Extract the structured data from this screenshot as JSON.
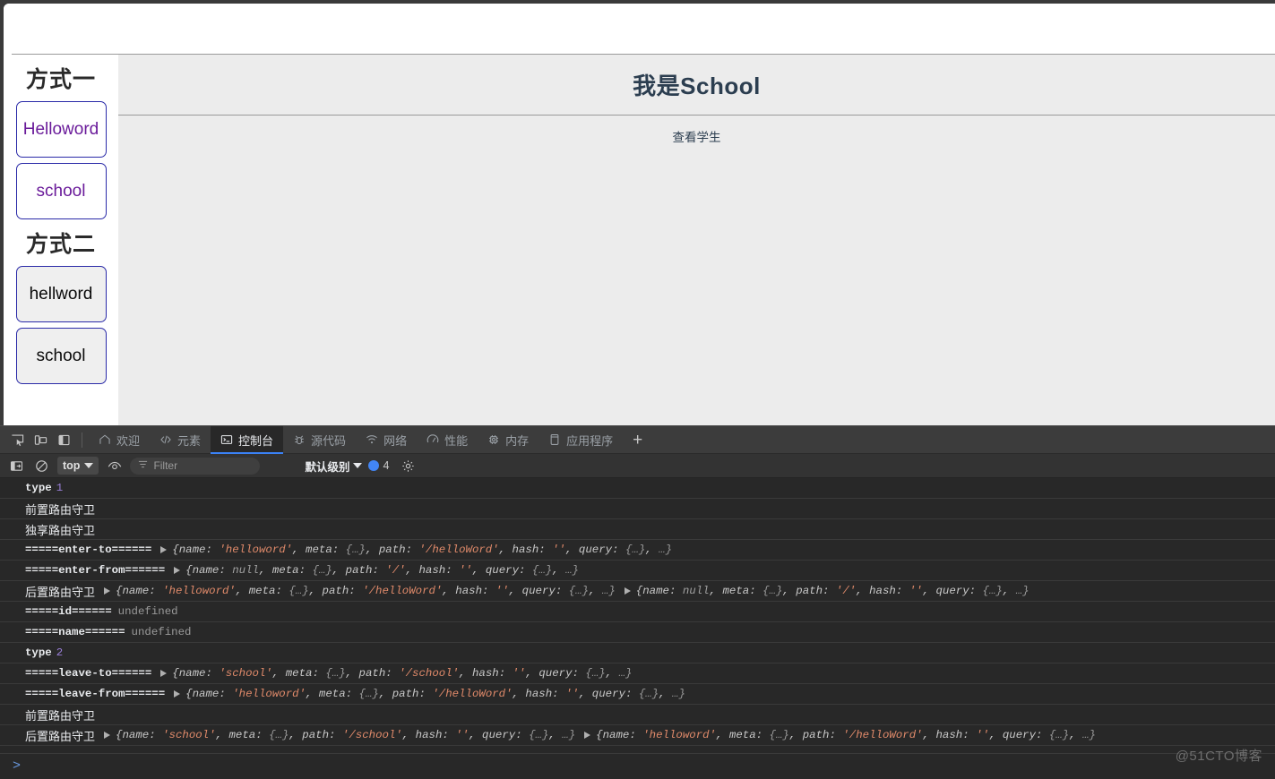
{
  "page": {
    "sidebar": {
      "section_one_title": "方式一",
      "links": [
        {
          "label": "Helloword",
          "name": "nav-link-helloword"
        },
        {
          "label": "school",
          "name": "nav-link-school"
        }
      ],
      "section_two_title": "方式二",
      "buttons": [
        {
          "label": "hellword",
          "name": "nav-button-hellword"
        },
        {
          "label": "school",
          "name": "nav-button-school"
        }
      ]
    },
    "main": {
      "title": "我是School",
      "link": "查看学生"
    }
  },
  "devtools": {
    "toolbar_icons": [
      {
        "name": "inspect-element-icon"
      },
      {
        "name": "device-toolbar-icon"
      },
      {
        "name": "dock-side-icon"
      }
    ],
    "tabs": [
      {
        "label": "欢迎",
        "icon": "home-icon",
        "active": false
      },
      {
        "label": "元素",
        "icon": "code-brackets-icon",
        "active": false
      },
      {
        "label": "控制台",
        "icon": "console-terminal-icon",
        "active": true
      },
      {
        "label": "源代码",
        "icon": "bug-icon",
        "active": false
      },
      {
        "label": "网络",
        "icon": "wifi-icon",
        "active": false
      },
      {
        "label": "性能",
        "icon": "gauge-icon",
        "active": false
      },
      {
        "label": "内存",
        "icon": "chip-icon",
        "active": false
      },
      {
        "label": "应用程序",
        "icon": "phone-icon",
        "active": false
      }
    ],
    "add_tab_label": "+",
    "filterbar": {
      "sidebar_toggle_icon": "show-console-sidebar-icon",
      "clear_icon": "clear-console-icon",
      "context_value": "top",
      "eye_icon": "live-expression-icon",
      "filter_placeholder": "Filter",
      "filter_value": "",
      "filter_icon": "filter-lines-icon",
      "level_value": "默认级别",
      "message_count": "4",
      "settings_icon": "gear-icon"
    },
    "console_rows": [
      {
        "id": "row-type-1",
        "label": "type",
        "kind": "number",
        "value": "1"
      },
      {
        "id": "row-qianzhi-1",
        "label": "前置路由守卫",
        "kind": "cjk-text"
      },
      {
        "id": "row-duxiang",
        "label": "独享路由守卫",
        "kind": "cjk-text"
      },
      {
        "id": "row-enter-to",
        "label": "=====enter-to======",
        "kind": "objects",
        "objects": [
          {
            "name_value": "'helloword'",
            "name_kind": "string",
            "path_value": "'/helloWord'"
          }
        ]
      },
      {
        "id": "row-enter-from",
        "label": "=====enter-from======",
        "kind": "objects",
        "objects": [
          {
            "name_value": "null",
            "name_kind": "null",
            "path_value": "'/'"
          }
        ]
      },
      {
        "id": "row-houzhi-1",
        "label": "后置路由守卫",
        "kind": "cjk-objects",
        "objects": [
          {
            "name_value": "'helloword'",
            "name_kind": "string",
            "path_value": "'/helloWord'"
          },
          {
            "name_value": "null",
            "name_kind": "null",
            "path_value": "'/'"
          }
        ]
      },
      {
        "id": "row-id",
        "label": "=====id======",
        "kind": "undefined",
        "value": "undefined"
      },
      {
        "id": "row-name",
        "label": "=====name======",
        "kind": "undefined",
        "value": "undefined"
      },
      {
        "id": "row-type-2",
        "label": "type",
        "kind": "number",
        "value": "2"
      },
      {
        "id": "row-leave-to",
        "label": "=====leave-to======",
        "kind": "objects",
        "objects": [
          {
            "name_value": "'school'",
            "name_kind": "string",
            "path_value": "'/school'"
          }
        ]
      },
      {
        "id": "row-leave-from",
        "label": "=====leave-from======",
        "kind": "objects",
        "objects": [
          {
            "name_value": "'helloword'",
            "name_kind": "string",
            "path_value": "'/helloWord'"
          }
        ]
      },
      {
        "id": "row-qianzhi-2",
        "label": "前置路由守卫",
        "kind": "cjk-text"
      },
      {
        "id": "row-houzhi-2",
        "label": "后置路由守卫",
        "kind": "cjk-objects",
        "objects": [
          {
            "name_value": "'school'",
            "name_kind": "string",
            "path_value": "'/school'"
          },
          {
            "name_value": "'helloword'",
            "name_kind": "string",
            "path_value": "'/helloWord'"
          }
        ]
      }
    ],
    "object_template": {
      "open": "{",
      "key_name": "name:",
      "key_meta": "meta:",
      "key_path": "path:",
      "key_hash": "hash:",
      "key_query": "query:",
      "collapsed": "{…}",
      "empty_string": "''",
      "ellipsis": "…}",
      "comma": ", "
    },
    "prompt_caret": ">"
  },
  "watermark": "@51CTO博客",
  "colors": {
    "accent_blue": "#3b82f6",
    "link_purple": "#6a1b9a",
    "button_border": "#2a2aa8",
    "devtools_bg": "#282828",
    "page_main_bg": "#ececec"
  }
}
